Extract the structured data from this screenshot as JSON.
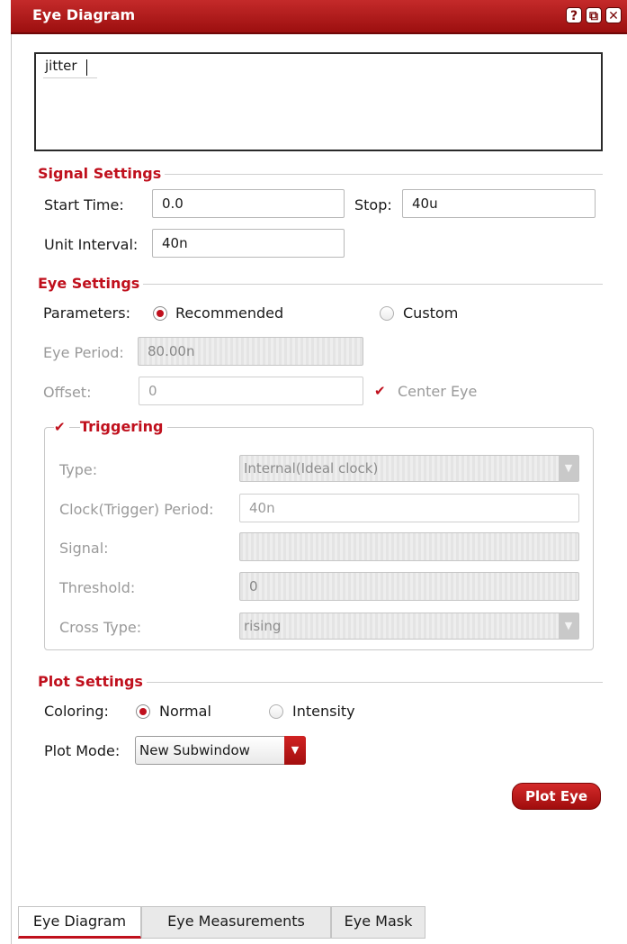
{
  "window": {
    "title": "Eye Diagram",
    "help_icon": "help-icon",
    "restore_icon": "restore-icon",
    "close_icon": "close-icon",
    "help_glyph": "?",
    "restore_glyph": "⧉",
    "close_glyph": "✕"
  },
  "editor": {
    "value": "jitter"
  },
  "signal_settings": {
    "heading": "Signal Settings",
    "start_label": "Start Time:",
    "start_value": "0.0",
    "stop_label": "Stop:",
    "stop_value": "40u",
    "unit_label": "Unit Interval:",
    "unit_value": "40n"
  },
  "eye_settings": {
    "heading": "Eye Settings",
    "parameters_label": "Parameters:",
    "recommended_label": "Recommended",
    "custom_label": "Custom",
    "selected": "Recommended",
    "period_label": "Eye Period:",
    "period_value": "80.00n",
    "offset_label": "Offset:",
    "offset_value": "0",
    "center_eye_label": "Center Eye",
    "center_eye_checked": true
  },
  "triggering": {
    "heading": "Triggering",
    "checked": true,
    "type_label": "Type:",
    "type_value": "Internal(Ideal clock)",
    "clock_label": "Clock(Trigger) Period:",
    "clock_value": "40n",
    "signal_label": "Signal:",
    "signal_value": "",
    "threshold_label": "Threshold:",
    "threshold_value": "0",
    "cross_label": "Cross Type:",
    "cross_value": "rising"
  },
  "plot_settings": {
    "heading": "Plot Settings",
    "coloring_label": "Coloring:",
    "normal_label": "Normal",
    "intensity_label": "Intensity",
    "selected": "Normal",
    "mode_label": "Plot Mode:",
    "mode_value": "New Subwindow",
    "plot_button": "Plot Eye"
  },
  "tabs": [
    {
      "label": "Eye Diagram",
      "active": true
    },
    {
      "label": "Eye Measurements",
      "active": false
    },
    {
      "label": "Eye Mask",
      "active": false
    }
  ],
  "colors": {
    "accent": "#c0101d",
    "titlebar": "#a81414"
  }
}
